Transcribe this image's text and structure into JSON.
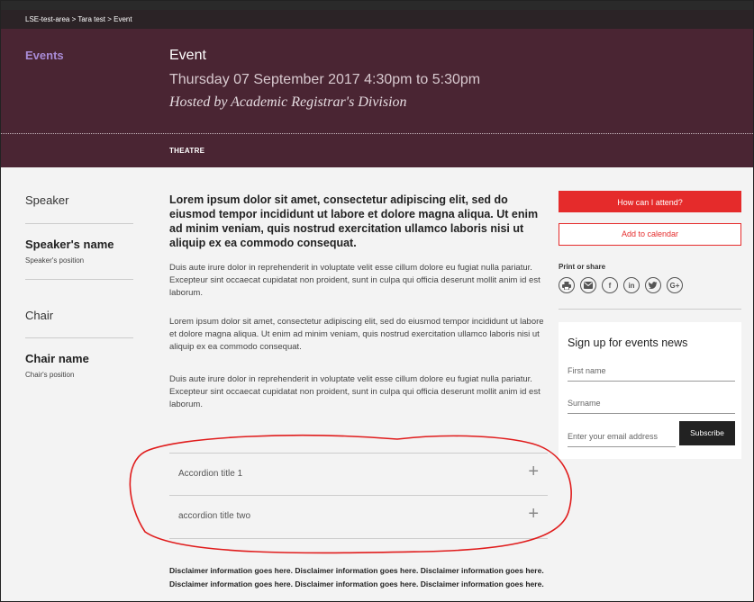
{
  "breadcrumb": "LSE-test-area > Tara test > Event",
  "hero": {
    "section_label": "Events",
    "title": "Event",
    "date": "Thursday 07 September 2017 4:30pm to 5:30pm",
    "host": "Hosted by Academic Registrar's Division",
    "venue": "THEATRE"
  },
  "left": {
    "speaker_heading": "Speaker",
    "speaker_name": "Speaker's name",
    "speaker_position": "Speaker's position",
    "chair_heading": "Chair",
    "chair_name": "Chair name",
    "chair_position": "Chair's position"
  },
  "main": {
    "lead": "Lorem ipsum dolor sit amet, consectetur adipiscing elit, sed do eiusmod tempor incididunt ut labore et dolore magna aliqua. Ut enim ad minim veniam, quis nostrud exercitation ullamco laboris nisi ut aliquip ex ea commodo consequat.",
    "para1": "Duis aute irure dolor in reprehenderit in voluptate velit esse cillum dolore eu fugiat nulla pariatur. Excepteur sint occaecat cupidatat non proident, sunt in culpa qui officia deserunt mollit anim id est laborum.",
    "para2": "Lorem ipsum dolor sit amet, consectetur adipiscing elit, sed do eiusmod tempor incididunt ut labore et dolore magna aliqua. Ut enim ad minim veniam, quis nostrud exercitation ullamco laboris nisi ut aliquip ex ea commodo consequat.",
    "para3": "Duis aute irure dolor in reprehenderit in voluptate velit esse cillum dolore eu fugiat nulla pariatur. Excepteur sint occaecat cupidatat non proident, sunt in culpa qui officia deserunt mollit anim id est laborum.",
    "accordions": [
      {
        "label": "Accordion title 1",
        "icon": "plus-icon"
      },
      {
        "label": "accordion title two",
        "icon": "plus-icon"
      }
    ],
    "disclaimer": "Disclaimer information goes here. Disclaimer information goes here. Disclaimer information goes here. Disclaimer information goes here. Disclaimer information goes here. Disclaimer information goes here."
  },
  "right": {
    "attend_label": "How can I attend?",
    "calendar_label": "Add to calendar",
    "share_label": "Print or share",
    "share_icons": [
      "print-icon",
      "email-icon",
      "facebook-icon",
      "linkedin-icon",
      "twitter-icon",
      "google-plus-icon"
    ],
    "signup": {
      "title": "Sign up for events news",
      "first_name_placeholder": "First name",
      "surname_placeholder": "Surname",
      "email_placeholder": "Enter your email address",
      "subscribe_label": "Subscribe"
    }
  },
  "colors": {
    "hero_bg": "#4a2533",
    "accent_red": "#e52b2b",
    "events_label": "#a98bd6"
  }
}
